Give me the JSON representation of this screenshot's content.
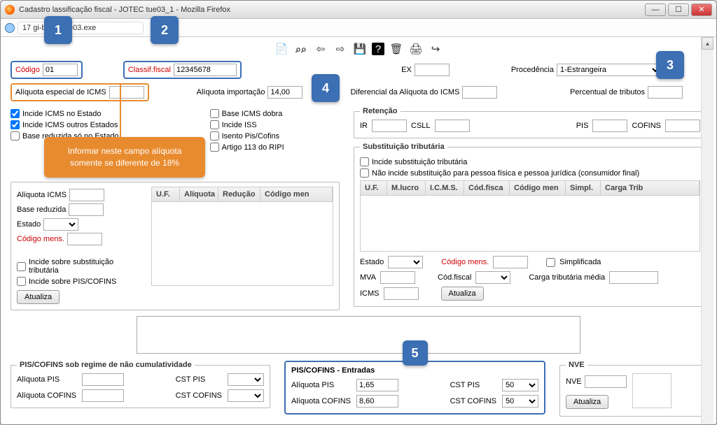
{
  "window": {
    "title": "Cadastro                  lassificação fiscal - JOTEC           tue03_1 - Mozilla Firefox",
    "url": "17               gi-bin/jtetue03.exe"
  },
  "steps": {
    "s1": "1",
    "s2": "2",
    "s3": "3",
    "s4": "4",
    "s5": "5"
  },
  "toolbar": {
    "new": "new",
    "binoc": "binoc",
    "back": "back",
    "fwd": "fwd",
    "save": "save",
    "help": "help",
    "trash": "trash",
    "print": "print",
    "exit": "exit"
  },
  "labels": {
    "codigo": "Código",
    "classif": "Classif.fiscal",
    "ex": "EX",
    "proced": "Procedência",
    "aliq_esp": "Alíquota especial de ICMS",
    "aliq_imp": "Alíquota importação",
    "dif_icms": "Diferencial da Alíquota do ICMS",
    "perc_trib": "Percentual de tributos",
    "inc_est": "Incide ICMS no Estado",
    "inc_out": "Incide ICMS outros Estados",
    "base_red": "Base reduzida só no Estado",
    "base_dob": "Base ICMS dobra",
    "inc_iss": "Incide ISS",
    "isento": "Isento Pis/Cofins",
    "art113": "Artigo 113 do RIPI",
    "ret": "Retenção",
    "ir": "IR",
    "csll": "CSLL",
    "pis": "PIS",
    "cofins": "COFINS",
    "subtrib": "Substituição tributária",
    "inc_sub": "Incide substituição tributária",
    "nao_inc": "Não incide substituição para pessoa física e pessoa jurídica (consumidor final)",
    "aliq_icms": "Alíquota ICMS",
    "base_reduz": "Base reduzida",
    "estado": "Estado",
    "cod_mens": "Código mens.",
    "inc_sobre_sub": "Incide sobre substituição tributária",
    "inc_sobre_pc": "Incide sobre PIS/COFINS",
    "atualiza": "Atualiza",
    "mva": "MVA",
    "cod_fiscal": "Cód.fiscal",
    "icms": "ICMS",
    "simpl": "Simplificada",
    "carga": "Carga tributária média",
    "pcnc": "PIS/COFINS sob regime de não cumulatividade",
    "pce": "PIS/COFINS - Entradas",
    "aliq_pis": "Alíquota PIS",
    "aliq_cof": "Alíquota COFINS",
    "cst_pis": "CST PIS",
    "cst_cof": "CST COFINS",
    "nve": "NVE"
  },
  "values": {
    "codigo": "01",
    "classif": "12345678",
    "aliq_imp": "14,00",
    "proced": "1-Estrangeira",
    "pce_pis": "1,65",
    "pce_cof": "8,60",
    "pce_cstpis": "50",
    "pce_cstcof": "50"
  },
  "headers": {
    "tbl1": [
      "U.F.",
      "Alíquota",
      "Redução",
      "Código men"
    ],
    "tbl2": [
      "U.F.",
      "M.lucro",
      "I.C.M.S.",
      "Cód.fisca",
      "Código men",
      "Simpl.",
      "Carga Trib"
    ]
  },
  "tip": "Informar neste campo alíquota somente se diferente de 18%"
}
